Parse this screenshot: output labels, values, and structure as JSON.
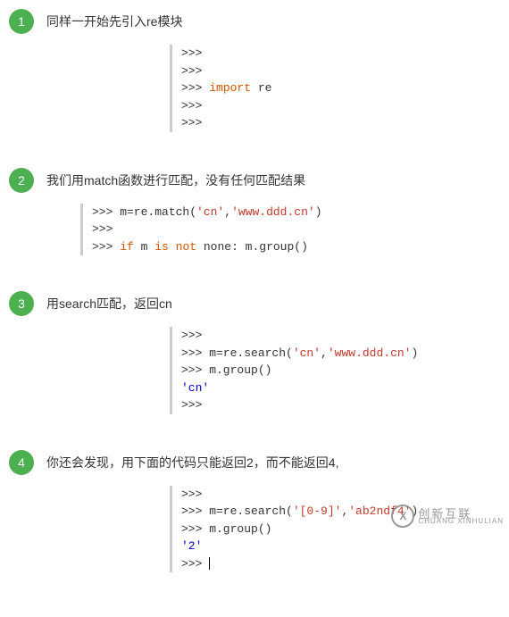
{
  "steps": [
    {
      "num": "1",
      "title": "同样一开始先引入re模块",
      "code_html": ">>>\n>>>\n>>> <span class='kw-orange'>import</span> re\n>>>\n>>>",
      "block_class": "mid"
    },
    {
      "num": "2",
      "title": "我们用match函数进行匹配，没有任何匹配结果",
      "code_html": ">>> m=re.match(<span class='str-red'>'cn'</span>,<span class='str-red'>'www.ddd.cn'</span>)\n>>>\n>>> <span class='kw-orange'>if</span> m <span class='kw-orange'>is</span> <span class='kw-orange'>not</span> none: m.group()",
      "block_class": "wide"
    },
    {
      "num": "3",
      "title": "用search匹配，返回cn",
      "code_html": ">>>\n>>> m=re.search(<span class='str-red'>'cn'</span>,<span class='str-red'>'www.ddd.cn'</span>)\n>>> m.group()\n<span class='kw-blue'>'cn'</span>\n>>>",
      "block_class": "mid"
    },
    {
      "num": "4",
      "title": "你还会发现，用下面的代码只能返回2，而不能返回4,",
      "code_html": ">>>\n>>> m=re.search(<span class='str-red'>'[0-9]'</span>,<span class='str-red'>'ab2ndf4'</span>)\n>>> m.group()\n<span class='kw-blue'>'2'</span>\n>>> <span class='cursor'></span>",
      "block_class": "mid"
    }
  ],
  "watermark": {
    "logo_text": "X",
    "cn": "创新互联",
    "en": "CHUANG XINHULIAN"
  }
}
